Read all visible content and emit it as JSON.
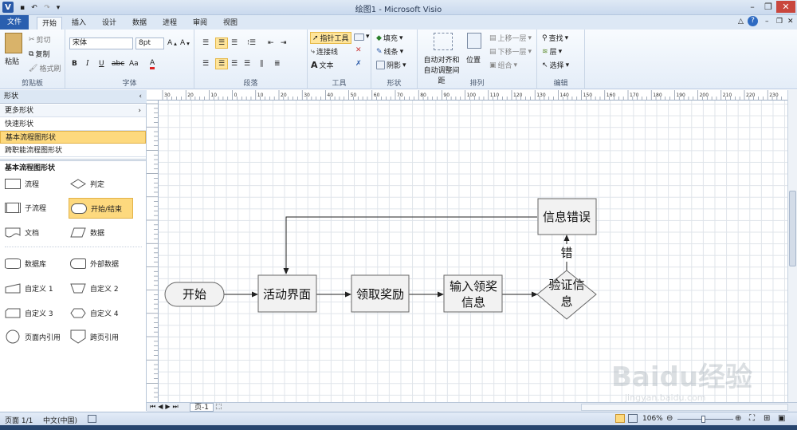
{
  "window": {
    "app_icon": "V",
    "title": "绘图1 - Microsoft Visio"
  },
  "tabs": [
    "文件",
    "开始",
    "插入",
    "设计",
    "数据",
    "进程",
    "审阅",
    "视图"
  ],
  "ribbon": {
    "clipboard": {
      "paste": "粘贴",
      "cut": "剪切",
      "copy": "复制",
      "format_painter": "格式刷",
      "label": "剪贴板"
    },
    "font": {
      "family": "宋体",
      "size": "8pt",
      "bold": "B",
      "italic": "I",
      "underline": "U",
      "strike": "abc",
      "case": "Aa",
      "color": "A",
      "label": "字体"
    },
    "paragraph": {
      "label": "段落"
    },
    "tools": {
      "pointer": "指针工具",
      "connector": "连接线",
      "text": "文本",
      "label": "工具"
    },
    "shape": {
      "fill": "填充",
      "line": "线条",
      "shadow": "阴影",
      "label": "形状"
    },
    "arrange": {
      "auto_align": "自动对齐和",
      "auto_space": "自动调整间距",
      "position": "位置",
      "bring_forward": "上移一层",
      "send_backward": "下移一层",
      "group": "组合",
      "label": "排列"
    },
    "editing": {
      "find": "查找",
      "layers": "层",
      "select": "选择",
      "label": "编辑"
    }
  },
  "shapes_pane": {
    "header": "形状",
    "more_shapes": "更多形状",
    "quick_shapes": "快速形状",
    "basic_flowchart": "基本流程图形状",
    "cross_functional": "跨职能流程图形状",
    "section_title": "基本流程图形状",
    "stencils": [
      "流程",
      "判定",
      "子流程",
      "开始/结束",
      "文档",
      "数据",
      "数据库",
      "外部数据",
      "自定义 1",
      "自定义 2",
      "自定义 3",
      "自定义 4",
      "页面内引用",
      "跨页引用"
    ]
  },
  "ruler_labels": [
    "30",
    "20",
    "10",
    "0",
    "10",
    "20",
    "30",
    "40",
    "50",
    "60",
    "70",
    "80",
    "90",
    "100",
    "110",
    "120",
    "130",
    "140",
    "150",
    "160",
    "170",
    "180",
    "190",
    "200",
    "210",
    "220",
    "230",
    "240",
    "250"
  ],
  "flowchart": {
    "start": "开始",
    "activity_page": "活动界面",
    "claim_reward": "领取奖励",
    "input_line1": "输入领奖",
    "input_line2": "信息",
    "verify_line1": "验证信",
    "verify_line2": "息",
    "info_error": "信息错误",
    "error_label": "错"
  },
  "page_tab": "页-1",
  "status": {
    "page": "页面 1/1",
    "language": "中文(中国)",
    "zoom": "106%"
  },
  "watermark": {
    "brand": "Baidu经验",
    "url": "jingyan.baidu.com"
  }
}
